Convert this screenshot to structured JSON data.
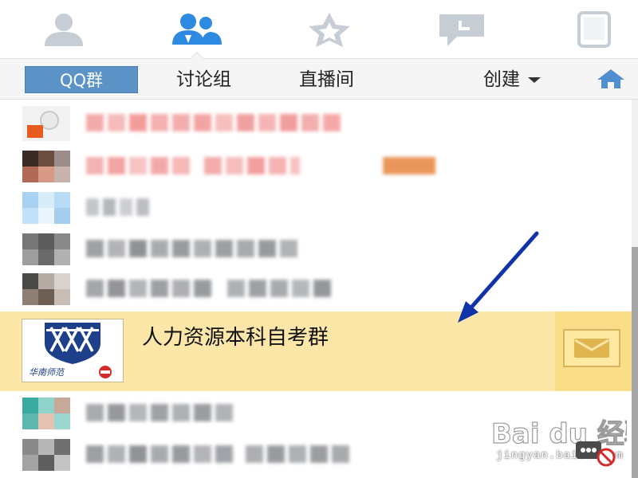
{
  "top_tabs": [
    {
      "icon": "contact-icon",
      "active": false
    },
    {
      "icon": "group-icon",
      "active": true
    },
    {
      "icon": "star-icon",
      "active": false
    },
    {
      "icon": "chat-bubble-icon",
      "active": false
    },
    {
      "icon": "tablet-icon",
      "active": false
    }
  ],
  "sub_tabs": {
    "qq_group": "QQ群",
    "discussion": "讨论组",
    "live_room": "直播间",
    "create": "创建"
  },
  "groups": {
    "selected_name": "人力资源本科自考群",
    "selected_badge": "华南师范"
  },
  "watermark": {
    "brand": "Bai du 经验",
    "domain": "jingyan.baidu.com"
  },
  "colors": {
    "accent": "#5b93c6",
    "selected_row": "#fce7a8",
    "arrow": "#1133aa"
  }
}
